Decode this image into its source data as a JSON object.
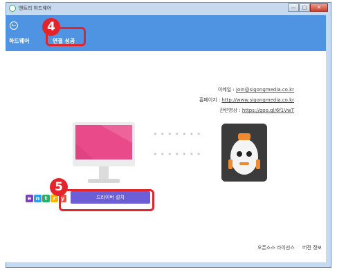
{
  "window": {
    "title": "엔트리 하드웨어",
    "minimize": "—",
    "maximize": "□",
    "close": "✕"
  },
  "header": {
    "back_label": "←",
    "crumb_hardware": "하드웨어",
    "crumb_status": "연결 성공"
  },
  "info": {
    "email_label": "이메일 : ",
    "email_value": "join@sigongmedia.co.kr",
    "homepage_label": "홈페이지 : ",
    "homepage_value": "http://www.sigongmedia.co.kr",
    "video_label": "관련영상 : ",
    "video_value": "https://goo.gl/6f1VwT"
  },
  "connection": {
    "dots_top": "•••••••",
    "dots_bottom": "•••••••"
  },
  "driver_button": {
    "label": "드라이버 설치"
  },
  "footer": {
    "oss_label": "오픈소스 라이선스",
    "version_label": "버전 정보"
  },
  "logo": {
    "letters": [
      "e",
      "n",
      "t",
      "r",
      "y"
    ],
    "colors": [
      "#7b3fc4",
      "#2a9df4",
      "#21b36a",
      "#ffb400",
      "#f24c3d"
    ]
  },
  "callouts": {
    "step4": "4",
    "step5": "5"
  },
  "colors": {
    "header_blue": "#4f94e3",
    "driver_purple": "#6c5ed6",
    "callout_red": "#e3242b",
    "monitor_pink": "#e94b8a"
  }
}
